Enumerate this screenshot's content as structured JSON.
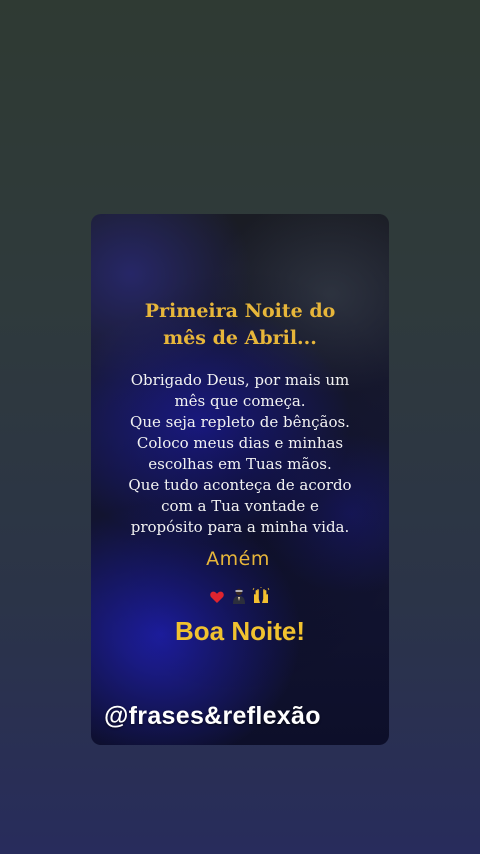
{
  "post": {
    "title_lines": [
      "Primeira Noite do",
      "mês de Abril..."
    ],
    "body_lines": [
      "Obrigado Deus, por mais um",
      "mês que começa.",
      "Que seja repleto de bênçãos.",
      "Coloco meus dias e minhas",
      "escolhas em Tuas mãos.",
      "Que tudo aconteça de acordo",
      "com a Tua vontade e",
      "propósito para a minha vida."
    ],
    "amen": "Amém",
    "emojis": [
      "heart-icon",
      "praying-icon",
      "raised-hands-icon"
    ],
    "greeting": "Boa Noite!",
    "handle": "@frases&reflexão"
  },
  "colors": {
    "gold_text": "#e7b63a",
    "greeting_text": "#f1c22f",
    "body_text": "#f2f2f2",
    "heart": "#e0242f"
  }
}
